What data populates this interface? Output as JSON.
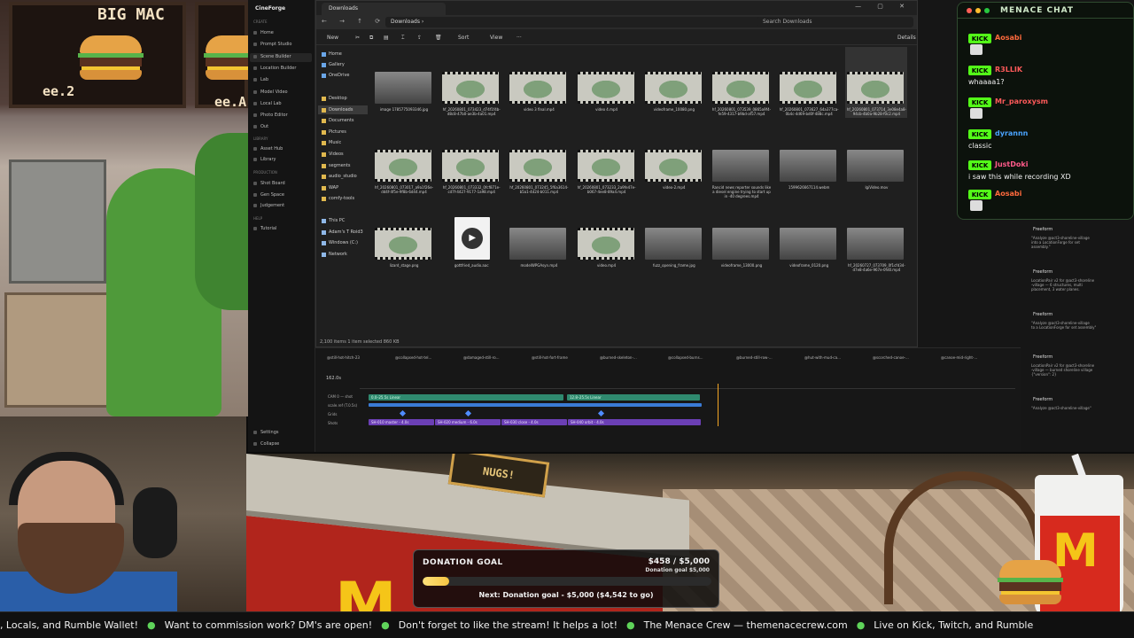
{
  "art": {
    "board_title": "BIG MAC",
    "price_left": "ee.2",
    "price_right": "ee.A"
  },
  "cineforge": {
    "brand": "CineForge",
    "section_create": "CREATE",
    "nav_create": [
      "Home",
      "Prompt Studio",
      "Scene Builder",
      "Location Builder",
      "Lab",
      "Model Video",
      "Local Lab",
      "Photo Editor",
      "Out"
    ],
    "section_library": "LIBRARY",
    "nav_library": [
      "Asset Hub",
      "Library"
    ],
    "section_production": "PRODUCTION",
    "nav_production": [
      "Shot Board",
      "Gen Space",
      "Judgement"
    ],
    "section_help": "HELP",
    "nav_help": [
      "Tutorial"
    ],
    "nav_bottom": [
      "Settings",
      "Collapse"
    ]
  },
  "explorer": {
    "tab_label": "Downloads",
    "window_controls": "— ▢ ✕",
    "nav_buttons": "← → ↑ ⟳",
    "path": "Downloads  ›",
    "search_placeholder": "Search Downloads",
    "toolbar": {
      "new": "New",
      "sort": "Sort",
      "view": "View",
      "more": "···",
      "details": "Details"
    },
    "sidebar": {
      "quick": [
        "Home",
        "Gallery",
        "OneDrive"
      ],
      "folders": [
        "Desktop",
        "Downloads",
        "Documents",
        "Pictures",
        "Music",
        "Videos",
        "segments",
        "audio_studio",
        "WAP",
        "comfy-tools"
      ],
      "pc": [
        "This PC",
        "Adam's T Roid3",
        "Windows (C:)",
        "Network"
      ]
    },
    "files": [
      {
        "name": "image 1785775093346.jpg",
        "kind": "image"
      },
      {
        "name": "hf_20260801_073423_d74f1f4b-d8c8-47b0-ae3b-4a01.mp4",
        "kind": "video"
      },
      {
        "name": "video 3 final.mp4",
        "kind": "video"
      },
      {
        "name": "video 4.mp4",
        "kind": "video"
      },
      {
        "name": "videoframe_10080.png",
        "kind": "video"
      },
      {
        "name": "hf_20260801_073539_0865a9f4-fe59-4317-b9bd-af57.mp4",
        "kind": "video"
      },
      {
        "name": "hf_20260801_073627_64a377ca-0b4c-4d69-bd0f-488c.mp4",
        "kind": "video"
      },
      {
        "name": "hf_20260801_073714_3e08e4a8-94cb-4b0a-9b28-f0c2.mp4",
        "kind": "video"
      },
      {
        "name": "hf_20260801_073017_a9a1f26e-dd4f-4f5e-9f8b-6d44.mp4",
        "kind": "video"
      },
      {
        "name": "hf_20260801_073332_0fcf871e-cd7f-4427-9177-1a98.mp4",
        "kind": "video"
      },
      {
        "name": "hf_20260801_073245_5f6a3614-b5a1-4d24-b011.mp4",
        "kind": "video"
      },
      {
        "name": "hf_20260801_073233_2a9fe47e-b067-4ee8-89a4.mp4",
        "kind": "video"
      },
      {
        "name": "video-2.mp4",
        "kind": "video"
      },
      {
        "name": "Rancid news reporter sounds like a diesel engine trying to start up in -40 degrees.mp4",
        "kind": "image"
      },
      {
        "name": "1599626667114.webm",
        "kind": "image"
      },
      {
        "name": "lgiVideo.mov",
        "kind": "image"
      },
      {
        "name": "lizard_stage.png",
        "kind": "video"
      },
      {
        "name": "gottfried_audio.aac",
        "kind": "audio"
      },
      {
        "name": "modelWPGAsyn.mp4",
        "kind": "image"
      },
      {
        "name": "video.mp4",
        "kind": "video"
      },
      {
        "name": "fuzz_opening_frame.jpg",
        "kind": "image"
      },
      {
        "name": "videoframe_13000.png",
        "kind": "image"
      },
      {
        "name": "videoframe_0120.png",
        "kind": "image"
      },
      {
        "name": "hf_20260727_073709_0f1cfd34-d7e8-4a6e-967e-0fd0.mp4",
        "kind": "image"
      }
    ],
    "status": "2,100 items   1 item selected  860 KB"
  },
  "timeline": {
    "chips": [
      "@still-hot-hitch-23",
      "@collapsed-hot-tel...",
      "@damaged-still-ro...",
      "@still-hot-fort-frame",
      "@burned-skeleton-...",
      "@collapsed-burns...",
      "@burned-still-row-...",
      "@hut-with-mud-ca...",
      "@scorched-canoe-...",
      "@canoe-mid-right-..."
    ],
    "time": "162.0s",
    "tracks": [
      "CAM 0 — shot",
      "scale.ref (T.0.5s)",
      "Grids",
      "Shots"
    ],
    "bar_cam": "0.0–25.5s  Linear",
    "bar_cam2": "12.8–25.5s  Linear",
    "shots": [
      "SH-010 master - 4.0s",
      "SH-020 medium - 6.0s",
      "SH-030 close - 4.0s",
      "SH-040 orbit - 4.0s"
    ]
  },
  "chat": {
    "title": "MENACE CHAT",
    "badge": "KICK",
    "messages": [
      {
        "user": "Aosabi",
        "color": "#ff6a3d",
        "text": ""
      },
      {
        "user": "R3LLIK",
        "color": "#ff5a5a",
        "text": "whaaaa1?"
      },
      {
        "user": "Mr_paroxysm",
        "color": "#ff5a5a",
        "text": ""
      },
      {
        "user": "dyrannn",
        "color": "#4aa3ff",
        "text": "classic"
      },
      {
        "user": "JustDoki",
        "color": "#ff5a8a",
        "text": "i saw this while recording XD"
      },
      {
        "user": "Aosabi",
        "color": "#ff6a3d",
        "text": ""
      }
    ]
  },
  "rpanel": {
    "cards": [
      {
        "head": "Freeform",
        "body": "\"Analyze @act3-shoreline-village\ninto a LocationForge for set\nassembly.\""
      },
      {
        "head": "Freeform",
        "body": "LocationPair v2 for @act3-shoreline\n-village — 6 structures, multi\nplacement, 3 water planes."
      },
      {
        "head": "Freeform",
        "body": "\"Analyze @act3-shoreline-village\nto a LocationForge for set assembly\""
      },
      {
        "head": "Freeform",
        "body": "LocationPair v2 for @act3-shoreline\n-village — burned shoreline village\n{\"version\": 2}"
      },
      {
        "head": "Freeform",
        "body": "\"Analyze @act3-shoreline-village\""
      }
    ]
  },
  "scene": {
    "sign": "NUGS!"
  },
  "donation": {
    "label": "DONATION GOAL",
    "amount": "$458 / $5,000",
    "goal_sub": "Donation goal $5,000",
    "progress": 0.0916,
    "next": "Next: Donation goal - $5,000 ($4,542 to go)"
  },
  "ticker": [
    "Patreon, Locals, and Rumble Wallet!",
    "Want to commission work? DM's are open!",
    "Don't forget to like the stream! It helps a lot!",
    "The Menace Crew — themenacecrew.com",
    "Live on Kick, Twitch, and Rumble"
  ]
}
